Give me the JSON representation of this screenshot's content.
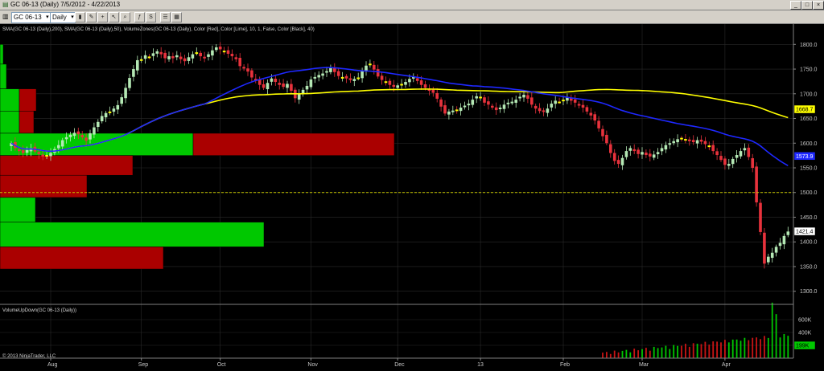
{
  "window": {
    "title": "GC 06-13 (Daily)  7/5/2012 - 4/22/2013"
  },
  "toolbar": {
    "instrument": "GC 06-13",
    "period": "Daily"
  },
  "chart": {
    "indicator_label": "SMA(GC 06-13 (Daily),200), SMA(GC 06-13 (Daily),50), VolumeZones(GC 06-13 (Daily), Color [Red], Color [Lime], 10, 1, False, Color [Black], 40)",
    "volume_panel_label": "VolumeUpDown(GC 06-13 (Daily))",
    "copyright": "© 2013 NinjaTrader, LLC"
  },
  "chart_data": {
    "type": "candlestick",
    "instrument": "GC 06-13",
    "period": "Daily",
    "date_range": "7/5/2012 - 4/22/2013",
    "price_axis": {
      "ylim": [
        1280,
        1820
      ],
      "ticks": [
        1300,
        1350,
        1400,
        1450,
        1500,
        1550,
        1600,
        1650,
        1700,
        1750,
        1800
      ]
    },
    "volume_axis": {
      "ylim": [
        0,
        800000
      ],
      "ticks": [
        "200K",
        "400K",
        "600K"
      ]
    },
    "x_ticks": [
      {
        "label": "Aug",
        "i": 10
      },
      {
        "label": "Sep",
        "i": 33
      },
      {
        "label": "Oct",
        "i": 53
      },
      {
        "label": "Nov",
        "i": 76
      },
      {
        "label": "Dec",
        "i": 98
      },
      {
        "label": "13",
        "i": 119
      },
      {
        "label": "Feb",
        "i": 140
      },
      {
        "label": "Mar",
        "i": 160
      },
      {
        "label": "Apr",
        "i": 181
      }
    ],
    "close": [
      1600,
      1590,
      1584,
      1580,
      1586,
      1590,
      1583,
      1578,
      1573,
      1576,
      1580,
      1588,
      1596,
      1606,
      1612,
      1617,
      1621,
      1618,
      1612,
      1605,
      1620,
      1632,
      1643,
      1655,
      1661,
      1664,
      1670,
      1677,
      1693,
      1712,
      1732,
      1750,
      1768,
      1770,
      1778,
      1774,
      1782,
      1786,
      1780,
      1772,
      1776,
      1772,
      1778,
      1770,
      1766,
      1774,
      1780,
      1784,
      1776,
      1772,
      1780,
      1788,
      1794,
      1790,
      1786,
      1781,
      1776,
      1770,
      1756,
      1752,
      1745,
      1733,
      1728,
      1718,
      1712,
      1722,
      1731,
      1724,
      1718,
      1714,
      1720,
      1706,
      1691,
      1699,
      1708,
      1716,
      1729,
      1734,
      1738,
      1741,
      1746,
      1752,
      1744,
      1736,
      1734,
      1731,
      1728,
      1730,
      1733,
      1746,
      1757,
      1761,
      1749,
      1735,
      1728,
      1724,
      1718,
      1714,
      1717,
      1720,
      1724,
      1730,
      1734,
      1726,
      1718,
      1712,
      1706,
      1702,
      1690,
      1674,
      1660,
      1664,
      1666,
      1668,
      1672,
      1676,
      1680,
      1688,
      1695,
      1694,
      1682,
      1678,
      1672,
      1667,
      1672,
      1678,
      1682,
      1684,
      1688,
      1694,
      1698,
      1690,
      1678,
      1670,
      1665,
      1664,
      1670,
      1680,
      1686,
      1684,
      1688,
      1692,
      1686,
      1682,
      1676,
      1672,
      1664,
      1656,
      1646,
      1630,
      1614,
      1600,
      1580,
      1564,
      1558,
      1570,
      1584,
      1590,
      1584,
      1578,
      1582,
      1576,
      1573,
      1577,
      1582,
      1590,
      1596,
      1600,
      1604,
      1608,
      1610,
      1608,
      1604,
      1602,
      1606,
      1603,
      1598,
      1594,
      1584,
      1576,
      1566,
      1556,
      1558,
      1568,
      1576,
      1584,
      1590,
      1572,
      1550,
      1480,
      1420,
      1356,
      1370,
      1378,
      1390,
      1398,
      1412,
      1421
    ],
    "volume_profile_zones": [
      {
        "price_from": 1800,
        "price_to": 1760,
        "up": 4,
        "down": 0
      },
      {
        "price_from": 1760,
        "price_to": 1710,
        "up": 8,
        "down": 0
      },
      {
        "price_from": 1710,
        "price_to": 1665,
        "up": 24,
        "down": 21
      },
      {
        "price_from": 1665,
        "price_to": 1620,
        "up": 24,
        "down": 18
      },
      {
        "price_from": 1620,
        "price_to": 1575,
        "up": 240,
        "down": 250
      },
      {
        "price_from": 1575,
        "price_to": 1535,
        "up": 0,
        "down": 165
      },
      {
        "price_from": 1535,
        "price_to": 1490,
        "up": 0,
        "down": 108
      },
      {
        "price_from": 1490,
        "price_to": 1440,
        "up": 44,
        "down": 0
      },
      {
        "price_from": 1440,
        "price_to": 1390,
        "up": 328,
        "down": 0
      },
      {
        "price_from": 1390,
        "price_to": 1345,
        "up": 0,
        "down": 203
      }
    ],
    "reference_line": 1500,
    "labels": {
      "sma200_last": "1668.7",
      "sma50_last": "1573.9",
      "last_price": "1421.4",
      "last_volume": "199K"
    }
  },
  "style": {
    "bg": "#000000",
    "grid": "#2a2a2a",
    "up_color": "#b4e8b4",
    "down_color": "#e8323c",
    "sma200_color": "#ffff00",
    "sma50_color": "#1e28ff",
    "zone_up": "#00c800",
    "zone_down": "#aa0000",
    "volume_up": "#00c800",
    "volume_down": "#c81414"
  },
  "icons": [
    "chart-icon",
    "draw-icon",
    "zoom-icon",
    "properties-icon",
    "close-icon",
    "minimize-icon",
    "maximize-icon"
  ]
}
